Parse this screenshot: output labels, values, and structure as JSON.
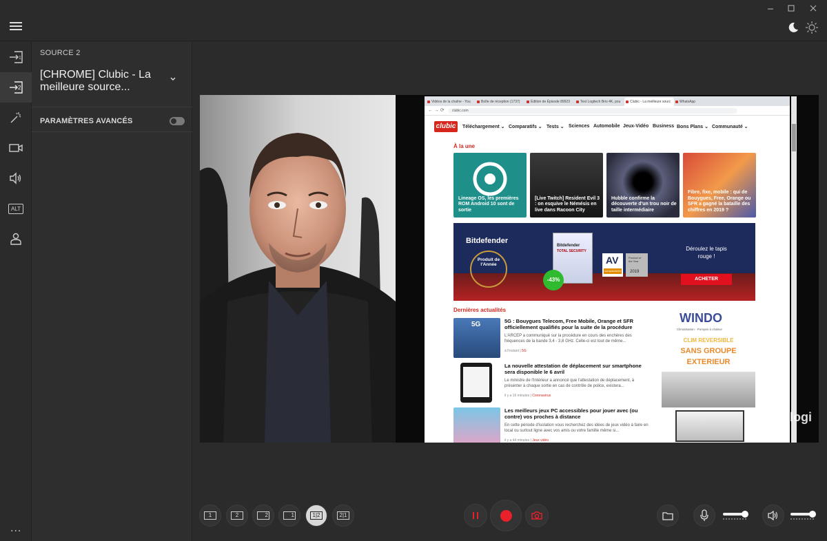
{
  "window": {
    "minimize_icon": "minimize-icon",
    "maximize_icon": "maximize-icon",
    "close_icon": "close-icon"
  },
  "topbar": {
    "menu_icon": "hamburger-icon",
    "dark_mode_icon": "moon-icon",
    "light_mode_icon": "sun-icon"
  },
  "rail": {
    "items": [
      {
        "icon": "source-1-icon"
      },
      {
        "icon": "source-2-icon",
        "active": true
      },
      {
        "icon": "magic-wand-icon"
      },
      {
        "icon": "camera-icon"
      },
      {
        "icon": "speaker-icon"
      },
      {
        "label": "ALT",
        "icon": "alt-icon"
      },
      {
        "icon": "user-icon"
      }
    ],
    "more": "..."
  },
  "panel": {
    "source_label": "SOURCE 2",
    "source_title": "[CHROME] Clubic - La meilleure source...",
    "advanced_label": "PARAMÈTRES AVANCÉS",
    "advanced_enabled": false
  },
  "browser": {
    "tabs": [
      "Vidéos de la chaîne - You",
      "Boîte de réception (1737)",
      "Édition de Épisode 89923",
      "Test Logitech Brio 4K, pou",
      "Clubic - La meilleure sourc",
      "WhatsApp"
    ],
    "url": "clubic.com",
    "logo": "clubic",
    "nav": [
      "Téléchargement ⌄",
      "Comparatifs ⌄",
      "Tests ⌄",
      "Sciences",
      "Automobile",
      "Jeux-Vidéo",
      "Business",
      "Bons Plans ⌄",
      "Communauté ⌄"
    ],
    "headline_section": "À la une",
    "cards": [
      "Lineage OS, les premières ROM Android 10 sont de sortie",
      "[Live Twitch] Resident Evil 3 : on esquive le Némésis en live dans Racoon City",
      "Hubble confirme la découverte d'un trou noir de taille intermédiaire",
      "Fibre, fixe, mobile : qui de Bouygues, Free, Orange ou SFR a gagné la bataille des chiffres en 2019 ?"
    ],
    "ad": {
      "brand": "Bitdefender",
      "award": "Produit de l'Année",
      "discount": "-43%",
      "box_line1": "Bitdefender",
      "box_line2": "TOTAL SECURITY",
      "av_logo": "AV",
      "av_sub": "comparatives",
      "av_badge": "Product of the Year",
      "av_year": "2019",
      "tagline": "Déroulez le tapis rouge !",
      "cta": "ACHETER"
    },
    "news_section": "Dernières actualités",
    "news": [
      {
        "title": "5G : Bouygues Telecom, Free Mobile, Orange et SFR officiellement qualifiés pour la suite de la procédure",
        "desc": "L'ARCEP a communiqué sur la procédure en cours des enchères des fréquences de la bande 3,4 - 3,8 GHz. Celle-ci est tout de même...",
        "meta_time": "à l'instant",
        "meta_tag": "5G",
        "thumb_label": "5G"
      },
      {
        "title": "La nouvelle attestation de déplacement sur smartphone sera disponible le 6 avril",
        "desc": "Le ministre de l'Intérieur a annoncé que l'attestation de déplacement, à présenter à chaque sortie en cas de contrôle de police, existera...",
        "meta_time": "il y a 16 minutes",
        "meta_tag": "Coronavirus",
        "thumb_label": ""
      },
      {
        "title": "Les meilleurs jeux PC accessibles pour jouer avec (ou contre) vos proches à distance",
        "desc": "En cette période d'isolation vous recherchez des idées de jeux vidéo à faire en local ou surtout ligne avec vos amis ou votre famille même si...",
        "meta_time": "il y a 44 minutes",
        "meta_tag": "Jeux vidéo",
        "thumb_label": ""
      }
    ],
    "side_ad": {
      "brand": "WINDO",
      "sub": "Climatisation - Pompes à chaleur",
      "line1": "CLIM REVERSIBLE",
      "line2": "SANS GROUPE",
      "line3": "EXTERIEUR"
    }
  },
  "watermark": "logi",
  "bottombar": {
    "layouts": [
      {
        "label": "1",
        "icon": "layout-single-1-icon"
      },
      {
        "label": "2",
        "icon": "layout-single-2-icon"
      },
      {
        "label": "2",
        "icon": "layout-pip-2-icon"
      },
      {
        "label": "1",
        "icon": "layout-pip-1-icon"
      },
      {
        "label": "1|2",
        "icon": "layout-split-icon",
        "active": true
      },
      {
        "label": "2|1",
        "icon": "layout-split-reverse-icon"
      }
    ],
    "pause_icon": "pause-icon",
    "record_icon": "record-icon",
    "snapshot_icon": "camera-snapshot-icon",
    "folder_icon": "folder-icon",
    "mic_icon": "microphone-icon",
    "mic_level": 1.0,
    "volume_icon": "speaker-icon",
    "volume_level": 1.0
  },
  "colors": {
    "background": "#2b2b2b",
    "accent_red": "#e8212b",
    "clubic_red": "#d6271e"
  }
}
